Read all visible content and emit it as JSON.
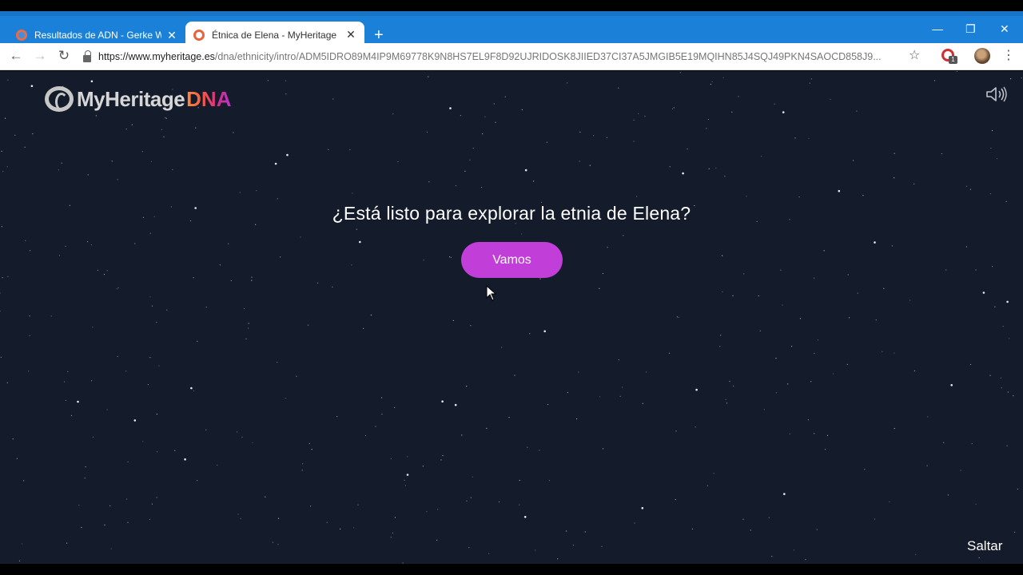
{
  "browser": {
    "tabs": [
      {
        "title": "Resultados de ADN - Gerke Web",
        "active": false,
        "favicon": "myheritage-icon"
      },
      {
        "title": "Étnica de Elena - MyHeritage",
        "active": true,
        "favicon": "myheritage-icon"
      }
    ],
    "new_tab": "+",
    "window_controls": {
      "minimize": "—",
      "restore": "❐",
      "close": "✕"
    },
    "url_host": "https://www.myheritage.es",
    "url_path": "/dna/ethnicity/intro/ADM5IDRO89M4IP9M69778K9N8HS7EL9F8D92UJRIDOSK8JIIED37CI37A5JMGIB5E19MQIHN85J4SQJ49PKN4SAOCD858J9...",
    "extension_badge": "1"
  },
  "page": {
    "logo_text": "MyHeritage",
    "logo_dna": "DNA",
    "question": "¿Está listo para explorar la etnia de Elena?",
    "start_button": "Vamos",
    "skip": "Saltar"
  },
  "colors": {
    "tabstrip": "#1b80d7",
    "background": "#141b2a",
    "button": "#c13ed8"
  }
}
